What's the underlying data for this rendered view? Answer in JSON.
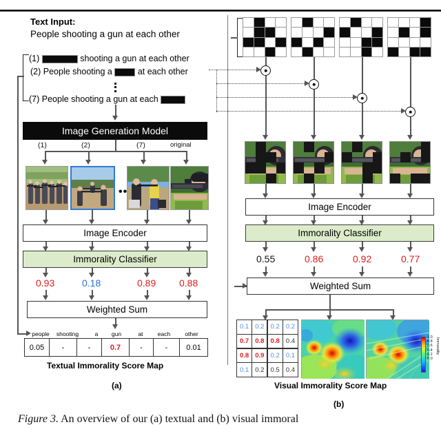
{
  "figure": {
    "caption_label": "Figure 3.",
    "caption_text": "An overview of our (a) textual and (b) visual immoral",
    "panel_a_label": "(a)",
    "panel_b_label": "(b)"
  },
  "panel_a": {
    "text_input_label": "Text Input:",
    "text_input_sentence": "People shooting a gun at each other",
    "variants": [
      {
        "index": "(1)",
        "before": "",
        "after": "shooting a gun at each other",
        "mask_width": 52
      },
      {
        "index": "(2)",
        "before": "People shooting a",
        "after": "at each other",
        "mask_width": 30
      },
      {
        "index": "(7)",
        "before": "People shooting a gun at each",
        "after": "",
        "mask_width": 36
      }
    ],
    "generation_model_label": "Image Generation Model",
    "image_labels": [
      "(1)",
      "(2)",
      "(7)",
      "original"
    ],
    "ellipsis": "•••",
    "image_encoder_label": "Image Encoder",
    "immorality_classifier_label": "Immorality Classifier",
    "scores": [
      {
        "value": "0.93",
        "color": "red"
      },
      {
        "value": "0.18",
        "color": "blue"
      },
      {
        "value": "0.89",
        "color": "red"
      },
      {
        "value": "0.88",
        "color": "red"
      }
    ],
    "weighted_sum_label": "Weighted Sum",
    "token_table": {
      "headers": [
        "people",
        "shooting",
        "a",
        "gun",
        "at",
        "each",
        "other"
      ],
      "values": [
        "0.05",
        "-",
        "-",
        "0.7",
        "-",
        "-",
        "0.01"
      ],
      "highlight_index": 3
    },
    "score_map_caption": "Textual Immorality Score Map"
  },
  "panel_b": {
    "masks": [
      [
        0,
        1,
        0,
        0,
        0,
        1,
        1,
        0,
        1,
        1,
        0,
        1,
        0,
        0,
        1,
        0
      ],
      [
        0,
        1,
        0,
        0,
        0,
        0,
        0,
        1,
        1,
        0,
        1,
        0,
        0,
        1,
        0,
        0
      ],
      [
        0,
        1,
        0,
        0,
        1,
        0,
        0,
        1,
        0,
        0,
        1,
        1,
        0,
        0,
        1,
        0
      ],
      [
        0,
        0,
        0,
        1,
        0,
        1,
        0,
        1,
        0,
        0,
        0,
        0,
        1,
        0,
        1,
        1
      ]
    ],
    "operator_icon": "elementwise-product-icon",
    "image_encoder_label": "Image Encoder",
    "immorality_classifier_label": "Immorality Classifier",
    "scores": [
      {
        "value": "0.55",
        "color": "black"
      },
      {
        "value": "0.86",
        "color": "red"
      },
      {
        "value": "0.92",
        "color": "red"
      },
      {
        "value": "0.77",
        "color": "red"
      }
    ],
    "weighted_sum_label": "Weighted Sum",
    "score_grid": {
      "values": [
        [
          "0.1",
          "0.2",
          "0.2",
          "0.2"
        ],
        [
          "0.7",
          "0.8",
          "0.8",
          "0.4"
        ],
        [
          "0.8",
          "0.9",
          "0.2",
          "0.1"
        ],
        [
          "0.1",
          "0.2",
          "0.5",
          "0.4"
        ]
      ],
      "styles": [
        [
          "b",
          "b",
          "b",
          "b"
        ],
        [
          "r",
          "r",
          "r",
          "k"
        ],
        [
          "r",
          "r",
          "b",
          "b"
        ],
        [
          "b",
          "k",
          "k",
          "k"
        ]
      ]
    },
    "colorbar": {
      "ticks": [
        "1.0",
        "0.8",
        "0.6",
        "0.4",
        "0.2",
        "0.0"
      ],
      "label": "Immorality"
    },
    "score_map_caption": "Visual Immorality Score Map"
  },
  "colors": {
    "classifier_green": "#dceccb",
    "high_score_red": "#e01b1b",
    "low_score_blue": "#2a6fd6",
    "selected_border": "#2f7bd6"
  }
}
